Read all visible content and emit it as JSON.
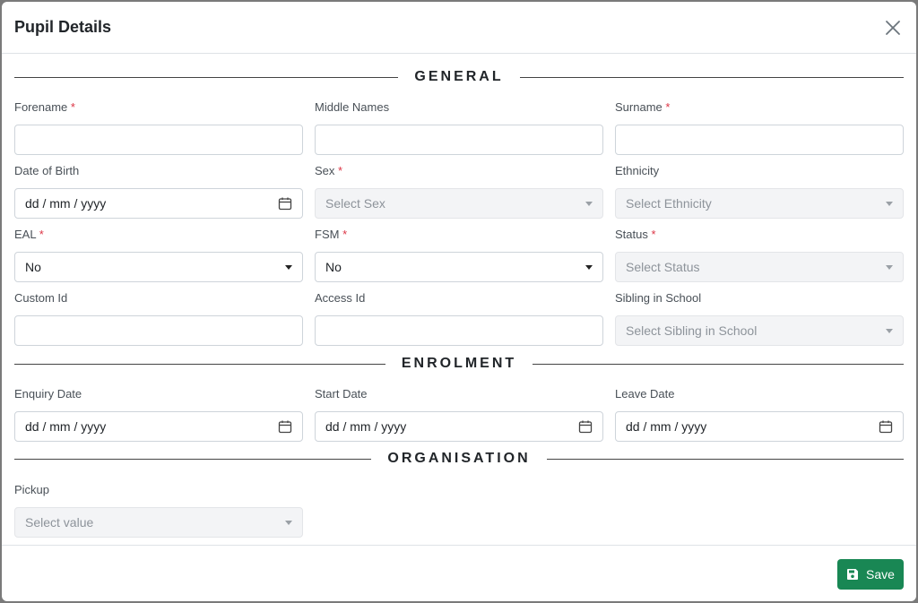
{
  "modal": {
    "title": "Pupil Details"
  },
  "sections": {
    "general": "GENERAL",
    "enrolment": "ENROLMENT",
    "organisation": "ORGANISATION"
  },
  "fields": {
    "forename": {
      "label": "Forename",
      "value": ""
    },
    "middle_names": {
      "label": "Middle Names",
      "value": ""
    },
    "surname": {
      "label": "Surname",
      "value": ""
    },
    "dob": {
      "label": "Date of Birth",
      "value": "dd / mm / yyyy"
    },
    "sex": {
      "label": "Sex",
      "value": "Select Sex"
    },
    "ethnicity": {
      "label": "Ethnicity",
      "value": "Select Ethnicity"
    },
    "eal": {
      "label": "EAL",
      "value": "No"
    },
    "fsm": {
      "label": "FSM",
      "value": "No"
    },
    "status": {
      "label": "Status",
      "value": "Select Status"
    },
    "custom_id": {
      "label": "Custom Id",
      "value": ""
    },
    "access_id": {
      "label": "Access Id",
      "value": ""
    },
    "sibling": {
      "label": "Sibling in School",
      "value": "Select Sibling in School"
    },
    "enquiry_date": {
      "label": "Enquiry Date",
      "value": "dd / mm / yyyy"
    },
    "start_date": {
      "label": "Start Date",
      "value": "dd / mm / yyyy"
    },
    "leave_date": {
      "label": "Leave Date",
      "value": "dd / mm / yyyy"
    },
    "pickup": {
      "label": "Pickup",
      "value": "Select value"
    }
  },
  "required_mark": "*",
  "footer": {
    "save_label": "Save"
  },
  "colors": {
    "primary_save": "#198754",
    "required": "#dc3545"
  },
  "icons": {
    "close": "close-icon",
    "calendar": "calendar-icon",
    "save": "floppy-disk-icon",
    "dropdown": "caret-down-icon"
  }
}
